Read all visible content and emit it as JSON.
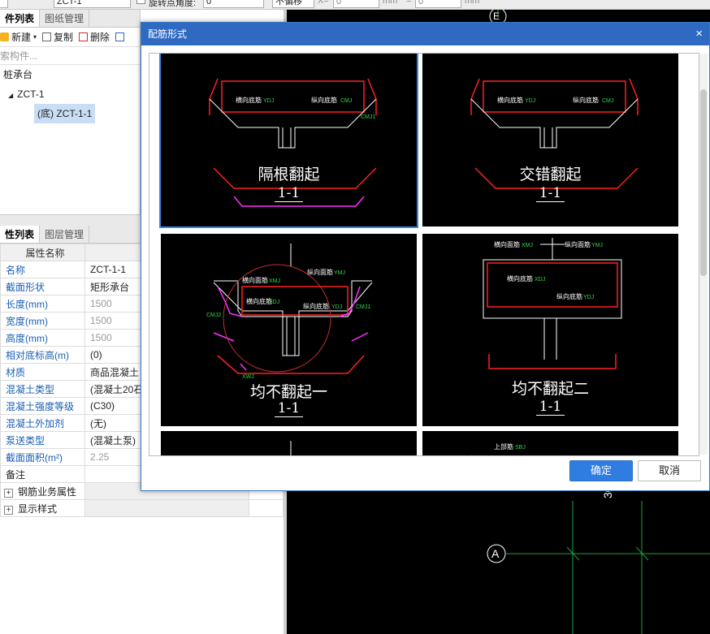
{
  "toolbar": {
    "field1": "",
    "component_select": "ZCT-1",
    "rotate_label": "旋转点角度:",
    "rotate_value": "0",
    "offset_select": "不偏移",
    "x_label": "X=",
    "x_value": "0",
    "mm_label": "mm",
    "y_label": "=",
    "y_value": "0",
    "mm_label2": "mm"
  },
  "component_list": {
    "tabs": [
      "件列表",
      "图纸管理"
    ],
    "actions": {
      "new": "新建",
      "copy": "复制",
      "delete": "删除"
    },
    "search_placeholder": "索构件...",
    "tree": {
      "root": "桩承台",
      "group": "ZCT-1",
      "item": "(底) ZCT-1-1"
    }
  },
  "property_list": {
    "tabs": [
      "性列表",
      "图层管理"
    ],
    "header": "属性名称",
    "rows": [
      {
        "name": "名称",
        "value": "ZCT-1-1"
      },
      {
        "name": "截面形状",
        "value": "矩形承台"
      },
      {
        "name": "长度(mm)",
        "value": "1500"
      },
      {
        "name": "宽度(mm)",
        "value": "1500"
      },
      {
        "name": "高度(mm)",
        "value": "1500"
      },
      {
        "name": "相对底标高(m)",
        "value": "(0)"
      },
      {
        "name": "材质",
        "value": "商品混凝土"
      },
      {
        "name": "混凝土类型",
        "value": "(混凝土20石"
      },
      {
        "name": "混凝土强度等级",
        "value": "(C30)"
      },
      {
        "name": "混凝土外加剂",
        "value": "(无)"
      },
      {
        "name": "泵送类型",
        "value": "(混凝土泵)"
      },
      {
        "name": "截面面积(m²)",
        "value": "2.25"
      },
      {
        "name": "备注",
        "value": ""
      }
    ],
    "groups": [
      "钢筋业务属性",
      "显示样式"
    ]
  },
  "dialog": {
    "title": "配筋形式",
    "close": "×",
    "options": [
      {
        "name": "隔根翻起",
        "section": "1-1"
      },
      {
        "name": "交错翻起",
        "section": "1-1"
      },
      {
        "name": "均不翻起一",
        "section": "1-1"
      },
      {
        "name": "均不翻起二",
        "section": "1-1"
      }
    ],
    "drawing_labels": {
      "transverse_top": "横向面筋",
      "longitudinal_top": "纵向面筋",
      "transverse_bottom": "横向底筋",
      "longitudinal_bottom": "纵向底筋",
      "side": "侧面筋",
      "top_steel": "上部筋",
      "tags": [
        "XMJ",
        "YMJ",
        "XDJ",
        "YDJ",
        "CMJ",
        "CMJ1",
        "CMJ2",
        "XWJ",
        "YWJ",
        "SBJ"
      ]
    },
    "ok": "确定",
    "cancel": "取消"
  },
  "canvas": {
    "axis_top": "E",
    "axis_bottom": "A",
    "dim": "30"
  },
  "colors": {
    "accent": "#2f7de1",
    "title_bar": "#2f6ac2",
    "rebar_red": "#ff2020",
    "rebar_magenta": "#ff30ff",
    "grid_green": "#1fa03c"
  }
}
